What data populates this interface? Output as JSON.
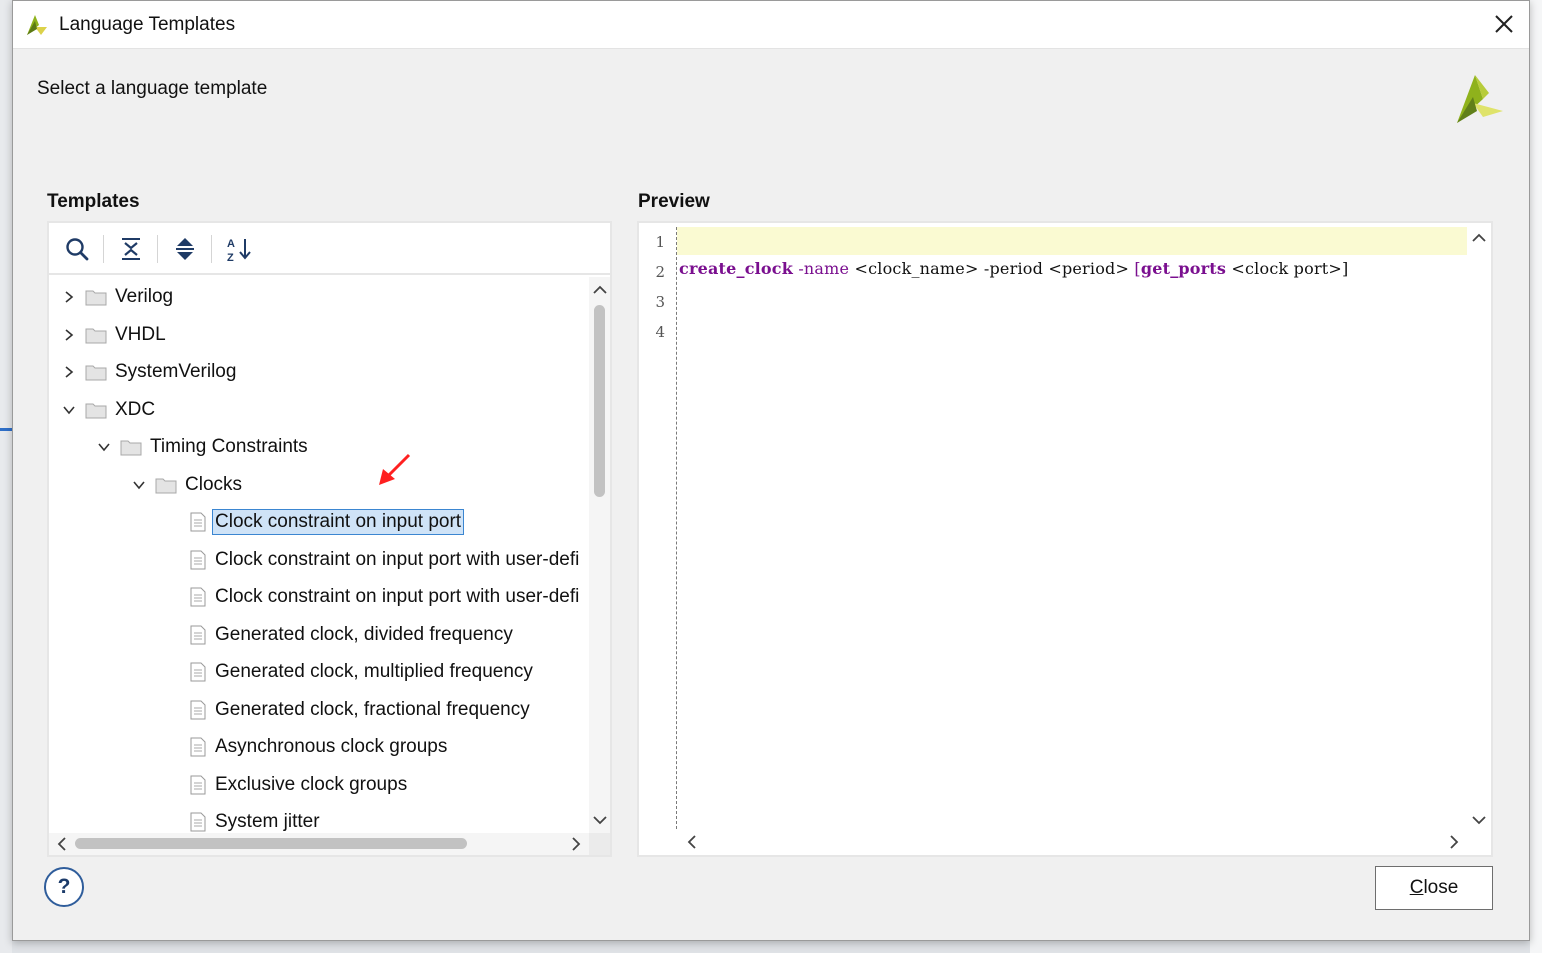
{
  "window": {
    "title": "Language Templates",
    "close_icon": "close-icon"
  },
  "header": {
    "subtitle": "Select a language template",
    "logo": "xilinx-logo"
  },
  "templates_panel": {
    "label": "Templates",
    "toolbar": [
      {
        "name": "search",
        "icon": "search-icon"
      },
      {
        "name": "collapse-all",
        "icon": "collapse-all-icon"
      },
      {
        "name": "expand-all",
        "icon": "expand-all-icon"
      },
      {
        "name": "sort",
        "icon": "sort-az-icon"
      }
    ],
    "tree": [
      {
        "label": "Verilog",
        "kind": "folder",
        "level": 0,
        "expanded": false
      },
      {
        "label": "VHDL",
        "kind": "folder",
        "level": 0,
        "expanded": false
      },
      {
        "label": "SystemVerilog",
        "kind": "folder",
        "level": 0,
        "expanded": false
      },
      {
        "label": "XDC",
        "kind": "folder",
        "level": 0,
        "expanded": true
      },
      {
        "label": "Timing Constraints",
        "kind": "folder",
        "level": 1,
        "expanded": true
      },
      {
        "label": "Clocks",
        "kind": "folder",
        "level": 2,
        "expanded": true
      },
      {
        "label": "Clock constraint on input port",
        "kind": "file",
        "level": 3,
        "selected": true
      },
      {
        "label": "Clock constraint on input port with user-defi",
        "kind": "file",
        "level": 3
      },
      {
        "label": "Clock constraint on input port with user-defi",
        "kind": "file",
        "level": 3
      },
      {
        "label": "Generated clock, divided frequency",
        "kind": "file",
        "level": 3
      },
      {
        "label": "Generated clock, multiplied frequency",
        "kind": "file",
        "level": 3
      },
      {
        "label": "Generated clock, fractional frequency",
        "kind": "file",
        "level": 3
      },
      {
        "label": "Asynchronous clock groups",
        "kind": "file",
        "level": 3
      },
      {
        "label": "Exclusive clock groups",
        "kind": "file",
        "level": 3
      },
      {
        "label": "System jitter",
        "kind": "file",
        "level": 3
      }
    ]
  },
  "preview_panel": {
    "label": "Preview",
    "line_numbers": [
      "1",
      "2",
      "3",
      "4"
    ],
    "code": {
      "cmd": "create_clock",
      "opt_name": "-name",
      "arg_name": "<clock_name>",
      "opt_period": "-period",
      "arg_period": "<period>",
      "bracket_open": "[",
      "get_ports": "get_ports",
      "arg_port": "<clock port>",
      "bracket_close": "]"
    }
  },
  "footer": {
    "help_label": "?",
    "close_label_mnemonic": "C",
    "close_label_rest": "lose"
  },
  "colors": {
    "selection_bg": "#cfe3f7",
    "selection_border": "#3b86d1",
    "keyword": "#7a0f8f",
    "current_line": "#fafad2",
    "annotation_arrow": "#ff2020"
  }
}
